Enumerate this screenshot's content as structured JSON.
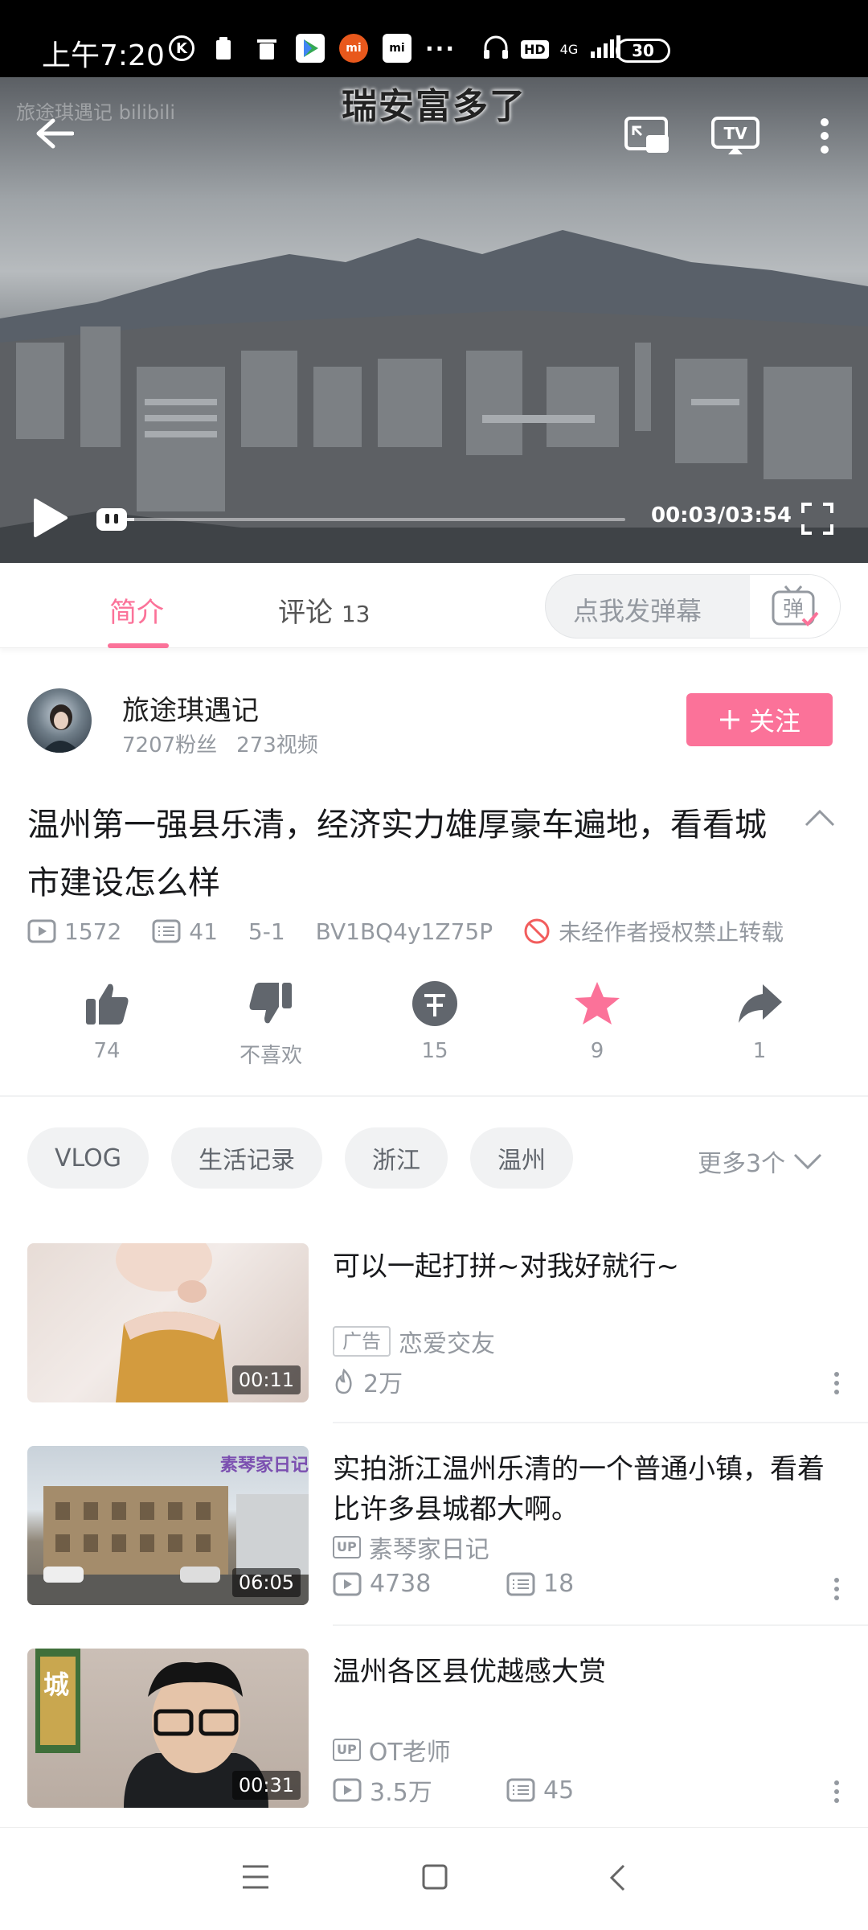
{
  "status_bar": {
    "time": "上午7:20",
    "network": "4G",
    "hd": "HD",
    "battery": "30"
  },
  "player": {
    "subtitle": "瑞安富多了",
    "watermark": "旅途琪遇记 bilibili",
    "time": "00:03/03:54",
    "progress_fraction": 0.014
  },
  "tabs": {
    "intro_label": "简介",
    "comments_label": "评论",
    "comments_count": "13",
    "danmaku_placeholder": "点我发弹幕",
    "danmaku_button": "弹"
  },
  "uploader": {
    "name": "旅途琪遇记",
    "fans": "7207粉丝",
    "videos": "273视频",
    "follow_label": "关注"
  },
  "video": {
    "title": "温州第一强县乐清，经济实力雄厚豪车遍地，看看城市建设怎么样",
    "views": "1572",
    "danmaku": "41",
    "date": "5-1",
    "bvid": "BV1BQ4y1Z75P",
    "copyright": "未经作者授权禁止转载"
  },
  "actions": {
    "like": "74",
    "dislike": "不喜欢",
    "coin": "15",
    "favorite": "9",
    "share": "1"
  },
  "tags": {
    "items": [
      "VLOG",
      "生活记录",
      "浙江",
      "温州"
    ],
    "more": "更多3个"
  },
  "related": [
    {
      "title": "可以一起打拼~对我好就行~",
      "duration": "00:11",
      "badge": "广告",
      "author": "恋爱交友",
      "heat": "2万"
    },
    {
      "title": "实拍浙江温州乐清的一个普通小镇，看着比许多县城都大啊。",
      "duration": "06:05",
      "thumb_text": "素琴家日记",
      "author": "素琴家日记",
      "views": "4738",
      "danmaku": "18"
    },
    {
      "title": "温州各区县优越感大赏",
      "duration": "00:31",
      "thumb_text": "城",
      "author": "OT老师",
      "views": "3.5万",
      "danmaku": "45"
    }
  ],
  "colors": {
    "accent": "#fb7299",
    "muted": "#9499a0"
  }
}
